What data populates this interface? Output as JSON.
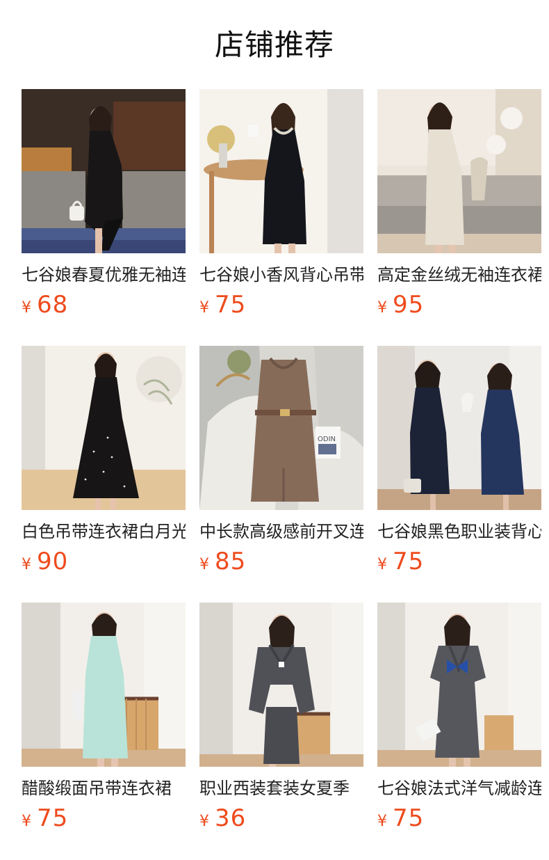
{
  "page": {
    "title": "店铺推荐"
  },
  "products": [
    {
      "name": "七谷娘春夏优雅无袖连衣裙",
      "currency": "¥",
      "price": "68",
      "image": "woman-black-sleeveless-dress-living-room"
    },
    {
      "name": "七谷娘小香风背心吊带连衣裙",
      "currency": "¥",
      "price": "75",
      "image": "woman-black-dress-with-collar"
    },
    {
      "name": "高定金丝绒无袖连衣裙",
      "currency": "¥",
      "price": "95",
      "image": "woman-cream-sleeveless-dress"
    },
    {
      "name": "白色吊带连衣裙白月光",
      "currency": "¥",
      "price": "90",
      "image": "woman-black-polka-dot-dress"
    },
    {
      "name": "中长款高级感前开叉连衣裙",
      "currency": "¥",
      "price": "85",
      "image": "brown-dress-on-sofa"
    },
    {
      "name": "七谷娘黑色职业装背心裙",
      "currency": "¥",
      "price": "75",
      "image": "two-women-navy-dresses"
    },
    {
      "name": "醋酸缎面吊带连衣裙",
      "currency": "¥",
      "price": "75",
      "image": "woman-mint-dress"
    },
    {
      "name": "职业西装套装女夏季",
      "currency": "¥",
      "price": "36",
      "image": "woman-gray-suit-set"
    },
    {
      "name": "七谷娘法式洋气减龄连衣裙",
      "currency": "¥",
      "price": "75",
      "image": "woman-gray-dress-blue-bow"
    }
  ]
}
